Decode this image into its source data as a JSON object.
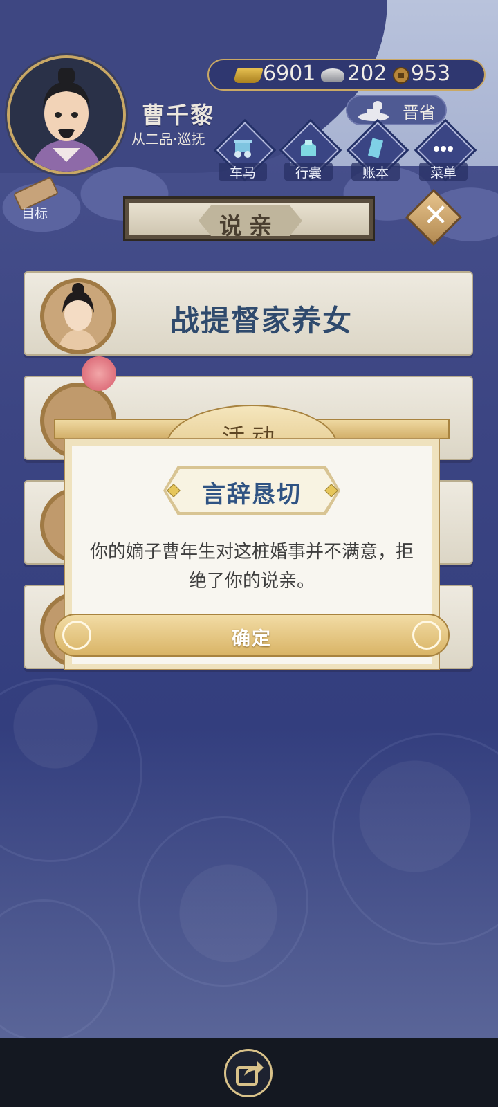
{
  "player": {
    "name": "曹千黎",
    "rank": "从二品·巡抚"
  },
  "currency": {
    "gold": "6901",
    "silver": "202",
    "coins": "953"
  },
  "province": "晋省",
  "menu": [
    {
      "label": "车马",
      "icon": "carriage-icon"
    },
    {
      "label": "行囊",
      "icon": "bag-icon"
    },
    {
      "label": "账本",
      "icon": "ledger-icon"
    },
    {
      "label": "菜单",
      "icon": "more-icon"
    }
  ],
  "goal_label": "目标",
  "page_title": "说亲",
  "list": [
    {
      "name": "战提督家养女"
    }
  ],
  "dialog": {
    "title": "活动",
    "badge": "言辞恳切",
    "message": "你的嫡子曹年生对这桩婚事并不满意，拒绝了你的说亲。",
    "ok": "确定"
  },
  "colors": {
    "background": "#3c4583",
    "gold": "#c9a865",
    "badge_text": "#2f5383"
  }
}
